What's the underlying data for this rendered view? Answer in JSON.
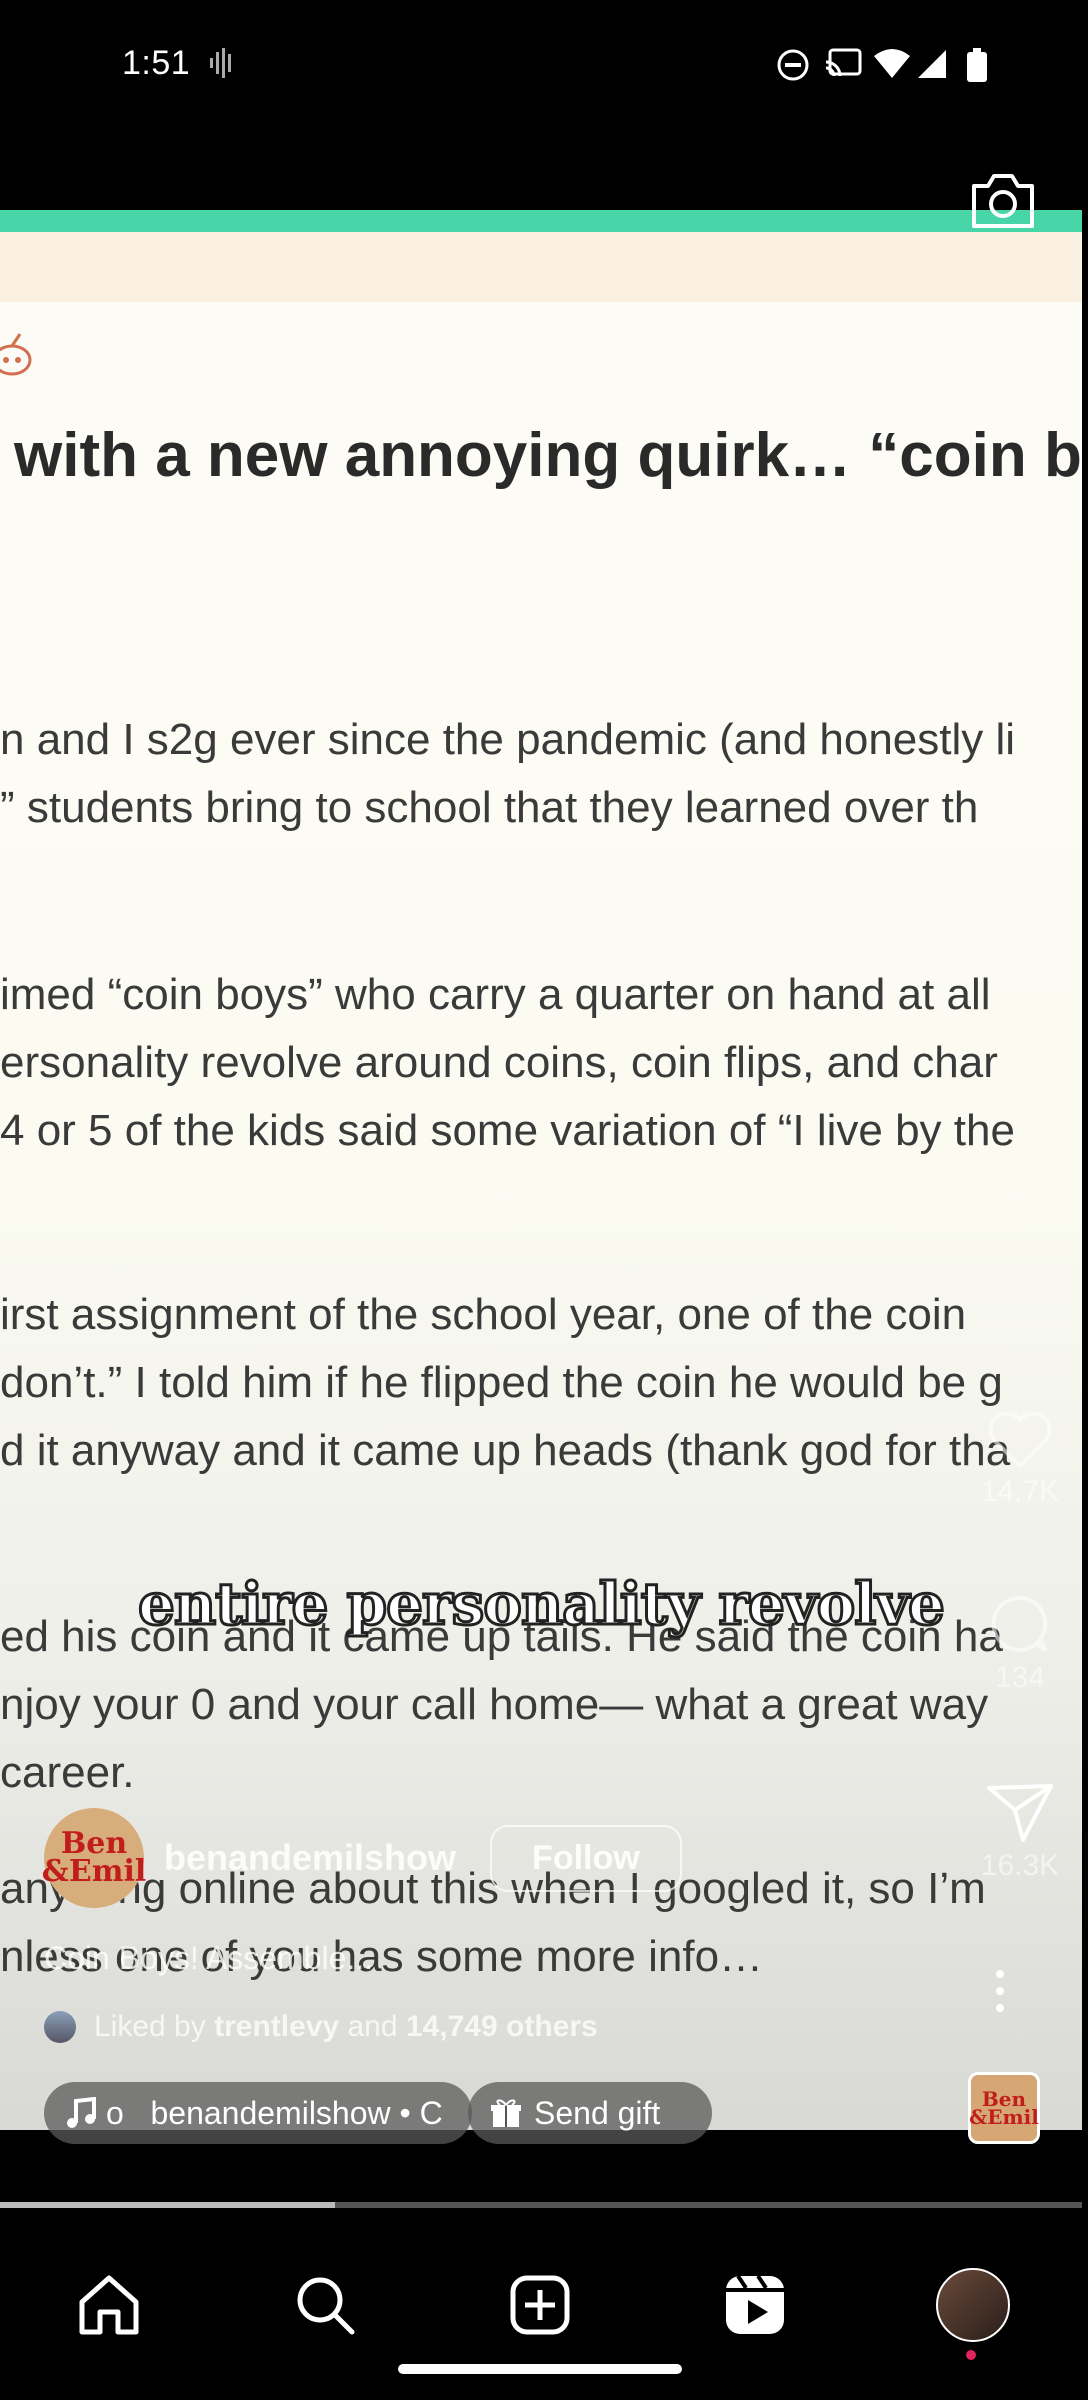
{
  "status_bar": {
    "time": "1:51"
  },
  "post": {
    "title": "with a new annoying quirk… “coin bo",
    "lines": [
      "n and I s2g ever since the pandemic (and honestly li",
      "” students bring to school that they learned over th",
      "imed “coin boys” who carry a quarter on hand at all",
      "ersonality revolve around coins, coin flips, and char",
      "4 or 5 of the kids said some variation of “I live by the",
      "irst assignment of the school year, one of the coin",
      "don’t.” I told him if he flipped the coin he would be g",
      "d it anyway and it came up heads (thank god for tha",
      "ed his coin and it came up tails. He said the coin ha",
      "njoy your 0 and your call home— what a great way",
      " career.",
      "anything online about this when I googled it, so I’m",
      "nless one of you has some more info…"
    ]
  },
  "caption_overlay": "entire personality revolve",
  "rail": {
    "likes": "14.7K",
    "comments": "134",
    "shares": "16.3K"
  },
  "owner": {
    "avatar_text": "Ben &Emil",
    "username": "benandemilshow",
    "follow_label": "Follow"
  },
  "reel_caption": "Coin Boys! Assemble...",
  "likes": {
    "prefix": "Liked by",
    "user": "trentlevy",
    "middle": "and",
    "others": "14,749 others"
  },
  "audio": {
    "label": "o   benandemilshow • C"
  },
  "gift": {
    "label": "Send gift"
  },
  "audio_thumb_text": "Ben &Emil",
  "progress": 0.31,
  "colors": {
    "accent_teal": "#48d6a8",
    "notification_dot": "#e0245e"
  }
}
